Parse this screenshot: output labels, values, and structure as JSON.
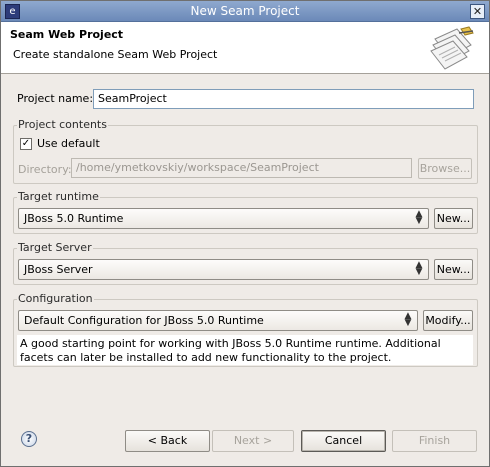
{
  "window": {
    "title": "New Seam Project"
  },
  "header": {
    "title": "Seam Web Project",
    "description": "Create standalone Seam Web Project"
  },
  "project_name": {
    "label": "Project name:",
    "value": "SeamProject"
  },
  "project_contents": {
    "legend": "Project contents",
    "use_default_label": "Use default",
    "use_default_checked": true,
    "directory_label": "Directory:",
    "directory_value": "/home/ymetkovskiy/workspace/SeamProject",
    "browse_label": "Browse..."
  },
  "target_runtime": {
    "legend": "Target runtime",
    "selected": "JBoss 5.0 Runtime",
    "new_label": "New..."
  },
  "target_server": {
    "legend": "Target Server",
    "selected": "JBoss Server",
    "new_label": "New..."
  },
  "configuration": {
    "legend": "Configuration",
    "selected": "Default Configuration for JBoss 5.0 Runtime",
    "modify_label": "Modify...",
    "description": "A good starting point for working with JBoss 5.0 Runtime runtime. Additional facets can later be installed to add new functionality to the project."
  },
  "footer": {
    "help_icon": "help-icon",
    "back_label": "< Back",
    "next_label": "Next >",
    "cancel_label": "Cancel",
    "finish_label": "Finish"
  }
}
